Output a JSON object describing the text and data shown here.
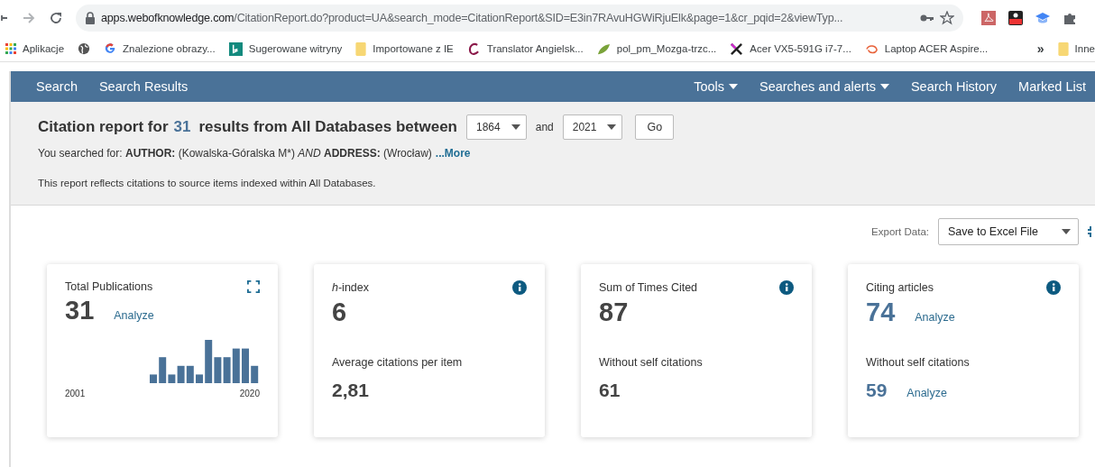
{
  "browser": {
    "url_host": "apps.webofknowledge.com",
    "url_path": "/CitationReport.do?product=UA&search_mode=CitationReport&SID=E3in7RAvuHGWiRjuElk&page=1&cr_pqid=2&viewTyp...",
    "bookmarks": [
      {
        "kind": "apps",
        "label": "Aplikacje"
      },
      {
        "kind": "globe"
      },
      {
        "kind": "google",
        "label": "Znalezione obrazy..."
      },
      {
        "kind": "bing",
        "label": "Sugerowane witryny"
      },
      {
        "kind": "folder",
        "label": "Importowane z IE"
      },
      {
        "kind": "c",
        "label": "Translator Angielsk..."
      },
      {
        "kind": "leaf",
        "label": "pol_pm_Mozga-trzc..."
      },
      {
        "kind": "x",
        "label": "Acer VX5-591G i7-7..."
      },
      {
        "kind": "swirl",
        "label": "Laptop ACER Aspire..."
      }
    ],
    "more": "»",
    "other_bookmarks": "Inne"
  },
  "nav": {
    "left": [
      "Search",
      "Search Results"
    ],
    "right": [
      {
        "label": "Tools",
        "dropdown": true
      },
      {
        "label": "Searches and alerts",
        "dropdown": true
      },
      {
        "label": "Search History",
        "dropdown": false
      },
      {
        "label": "Marked List",
        "dropdown": false
      }
    ]
  },
  "report": {
    "title_before": "Citation report for",
    "count": "31",
    "title_after": "results from All Databases between",
    "from_year": "1864",
    "and": "and",
    "to_year": "2021",
    "go": "Go",
    "query": "You searched for: **AUTHOR:** (Kowalska-Góralska M*) *AND* **ADDRESS:** (Wrocław)",
    "more": "...More",
    "note": "This report reflects citations to source items indexed within All Databases."
  },
  "export": {
    "label": "Export Data:",
    "value": "Save to Excel File"
  },
  "cards": [
    {
      "kind": "chart",
      "title": "Total Publications",
      "value": "31",
      "linked": false,
      "analyze": "Analyze",
      "axis_start": "2001",
      "axis_end": "2020"
    },
    {
      "kind": "stat",
      "title": "*h*-index",
      "value": "6",
      "linked": false,
      "sub_label": "Average citations per item",
      "sub_value": "2,81"
    },
    {
      "kind": "stat",
      "title": "Sum of Times Cited",
      "value": "87",
      "linked": false,
      "sub_label": "Without self citations",
      "sub_value": "61"
    },
    {
      "kind": "stat",
      "title": "Citing articles",
      "value": "74",
      "linked": true,
      "analyze": "Analyze",
      "sub_label": "Without self citations",
      "sub_value": "59",
      "sub_analyze": "Analyze"
    }
  ]
}
